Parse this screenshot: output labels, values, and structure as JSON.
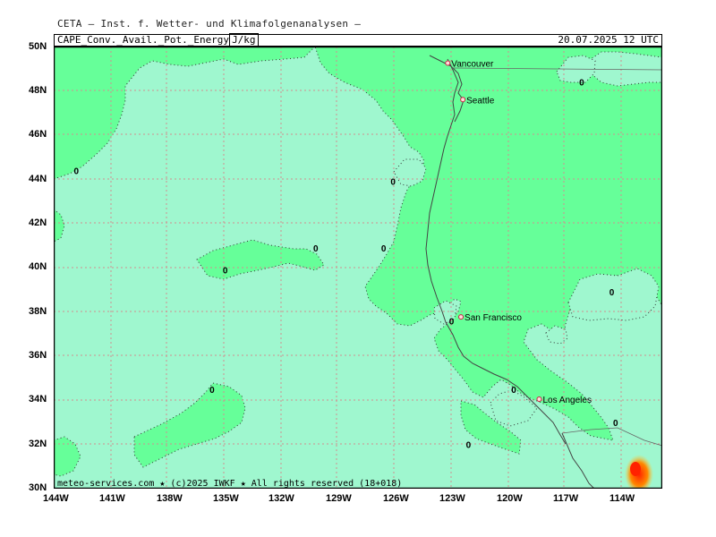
{
  "header": {
    "institute": "CETA — Inst. f. Wetter- und Klimafolgenanalysen —",
    "parameter": "CAPE_Conv._Avail._Pot._Energy",
    "unit": "J/kg",
    "datetime": "20.07.2025 12 UTC"
  },
  "footer": {
    "credit": "meteo-services.com ★ (c)2025 IWKF ★ All rights reserved (18+018)"
  },
  "axes": {
    "lat_labels": [
      "50N",
      "48N",
      "46N",
      "44N",
      "42N",
      "40N",
      "38N",
      "36N",
      "34N",
      "32N",
      "30N"
    ],
    "lon_labels": [
      "144W",
      "141W",
      "138W",
      "135W",
      "132W",
      "129W",
      "126W",
      "123W",
      "120W",
      "117W",
      "114W"
    ]
  },
  "cities": [
    {
      "name": "Vancouver",
      "lat": 49.25,
      "lon": -123.1
    },
    {
      "name": "Seattle",
      "lat": 47.6,
      "lon": -122.3
    },
    {
      "name": "San Francisco",
      "lat": 37.77,
      "lon": -122.4
    },
    {
      "name": "Los Angeles",
      "lat": 34.05,
      "lon": -118.25
    }
  ],
  "contour_labels": [
    {
      "text": "0",
      "lat": 48.4,
      "lon": -116.0
    },
    {
      "text": "0",
      "lat": 44.4,
      "lon": -142.8
    },
    {
      "text": "0",
      "lat": 43.9,
      "lon": -126.0
    },
    {
      "text": "0",
      "lat": 40.9,
      "lon": -130.1
    },
    {
      "text": "0",
      "lat": 40.9,
      "lon": -126.5
    },
    {
      "text": "0",
      "lat": 39.9,
      "lon": -134.9
    },
    {
      "text": "0",
      "lat": 38.9,
      "lon": -114.4
    },
    {
      "text": "0",
      "lat": 37.6,
      "lon": -122.9
    },
    {
      "text": "0",
      "lat": 34.5,
      "lon": -135.6
    },
    {
      "text": "0",
      "lat": 34.5,
      "lon": -119.6
    },
    {
      "text": "0",
      "lat": 33.0,
      "lon": -114.2
    },
    {
      "text": "0",
      "lat": 32.0,
      "lon": -122.0
    }
  ],
  "colors": {
    "ocean_zero": "#9ff7cf",
    "land_low": "#66ff99",
    "grid": "#d28f8f",
    "cape_hot": "#ff3300"
  }
}
